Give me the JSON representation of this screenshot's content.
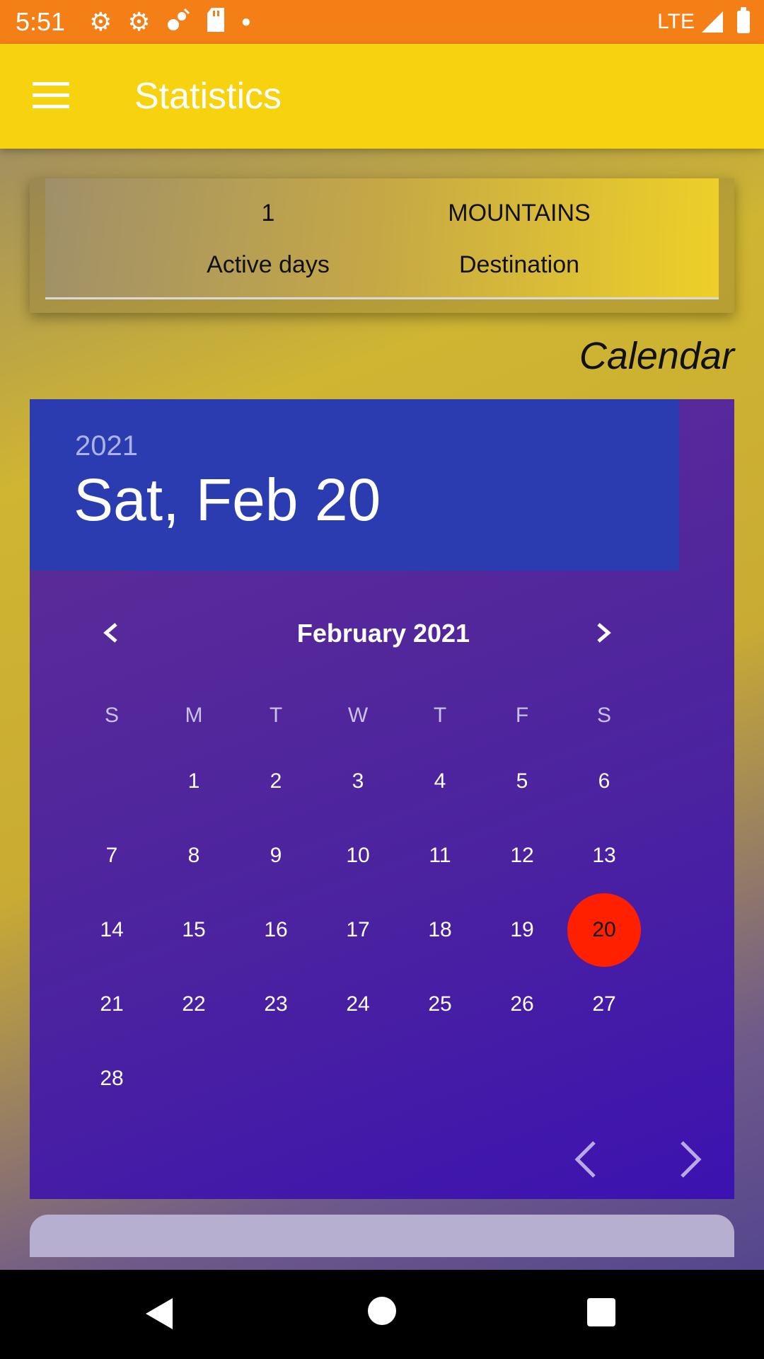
{
  "status_bar": {
    "time": "5:51",
    "network": "LTE",
    "icons": [
      "gear-icon",
      "gear-icon",
      "signal-off-icon",
      "sd-card-icon",
      "dot-icon"
    ]
  },
  "app_bar": {
    "title": "Statistics",
    "menu_icon": "hamburger-icon"
  },
  "stats": {
    "items": [
      {
        "value": "1",
        "label": "Active days"
      },
      {
        "value": "MOUNTAINS",
        "label": "Destination"
      }
    ]
  },
  "calendar_label": "Calendar",
  "calendar": {
    "year": "2021",
    "selected_date": "Sat, Feb 20",
    "month_title": "February 2021",
    "weekday_headers": [
      "S",
      "M",
      "T",
      "W",
      "T",
      "F",
      "S"
    ],
    "weeks": [
      [
        "",
        "1",
        "2",
        "3",
        "4",
        "5",
        "6"
      ],
      [
        "7",
        "8",
        "9",
        "10",
        "11",
        "12",
        "13"
      ],
      [
        "14",
        "15",
        "16",
        "17",
        "18",
        "19",
        "20"
      ],
      [
        "21",
        "22",
        "23",
        "24",
        "25",
        "26",
        "27"
      ],
      [
        "28",
        "",
        "",
        "",
        "",
        "",
        ""
      ]
    ],
    "selected_day": "20",
    "selected_color": "#ff2000"
  },
  "colors": {
    "status_bar": "#f57f17",
    "app_bar": "#f6d20f",
    "calendar_header": "#2b3cb0",
    "calendar_body": "#4b22a0"
  }
}
